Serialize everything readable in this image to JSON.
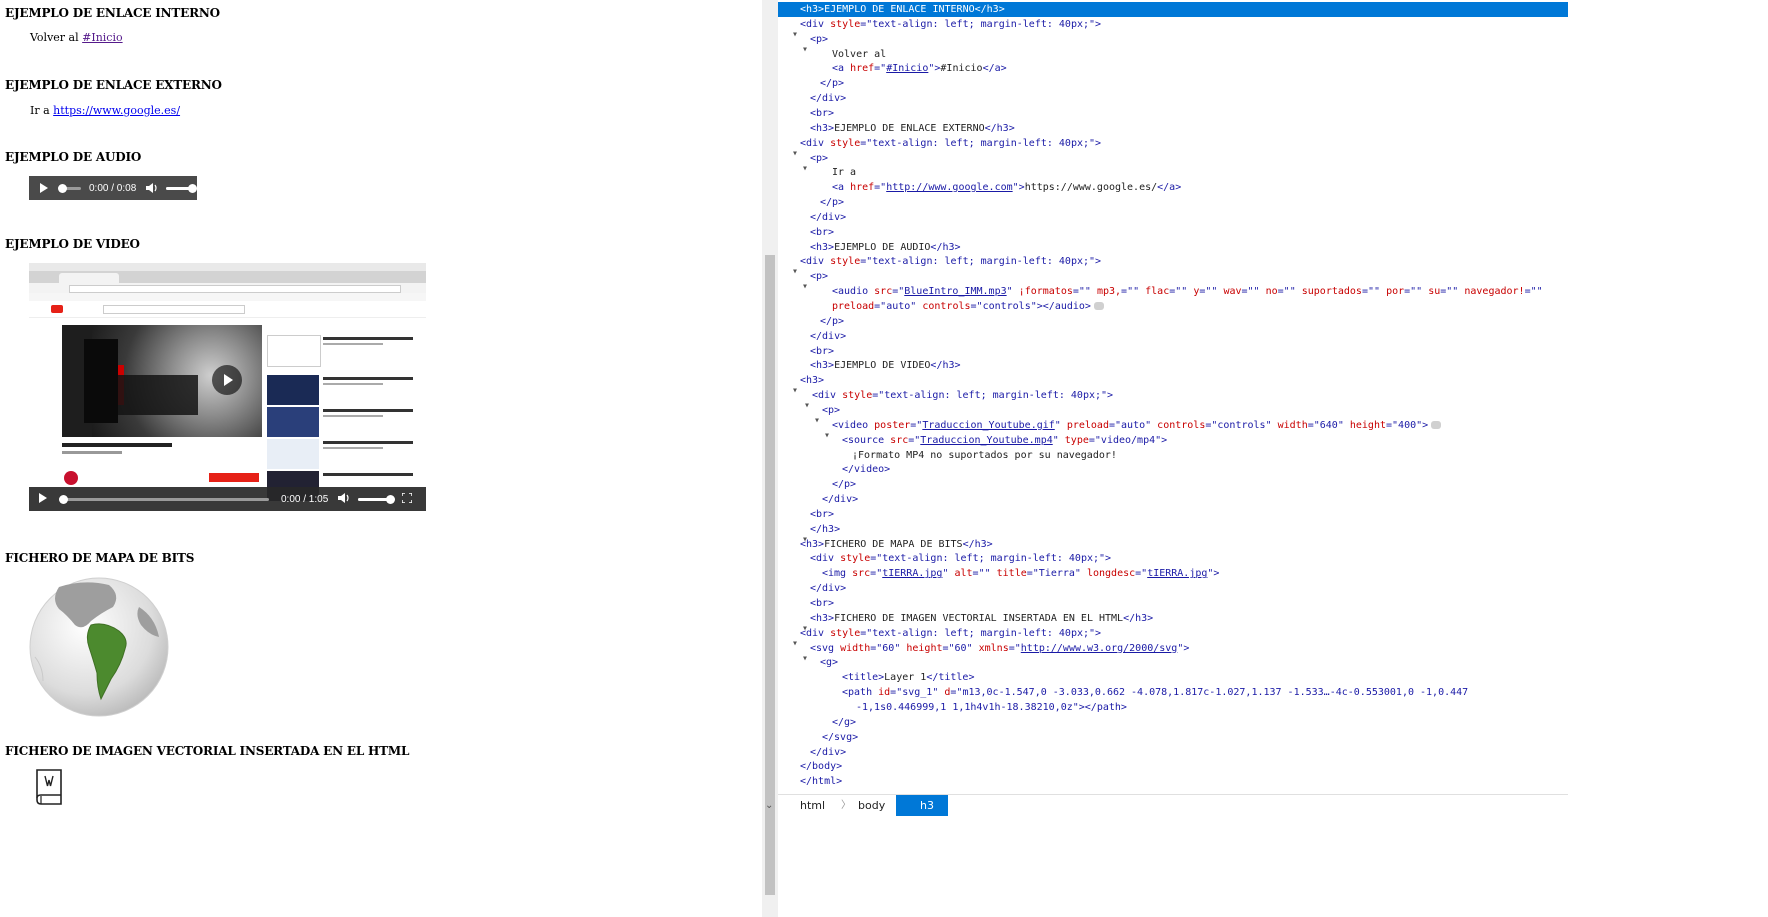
{
  "page": {
    "sections": {
      "internal_link": {
        "heading": "EJEMPLO DE ENLACE INTERNO",
        "text": "Volver al ",
        "link": "#Inicio"
      },
      "external_link": {
        "heading": "EJEMPLO DE ENLACE EXTERNO",
        "text": "Ir a ",
        "link": "https://www.google.es/"
      },
      "audio": {
        "heading": "EJEMPLO DE AUDIO",
        "time": "0:00 / 0:08"
      },
      "video": {
        "heading": "EJEMPLO DE VIDEO",
        "time": "0:00 / 1:05"
      },
      "bitmap": {
        "heading": "FICHERO DE MAPA DE BITS"
      },
      "vector": {
        "heading": "FICHERO DE IMAGEN VECTORIAL INSERTADA EN EL HTML"
      }
    }
  },
  "devtools": {
    "dom_lines": [
      [
        [
          "t",
          "<h3>"
        ],
        [
          "x",
          "EJEMPLO DE ENLACE INTERNO"
        ],
        [
          "t",
          "</h3>"
        ]
      ],
      [
        [
          "t",
          "<div "
        ],
        [
          "an",
          "style"
        ],
        [
          "t",
          "=\""
        ],
        [
          "av",
          "text-align: left; margin-left: 40px;"
        ],
        [
          "t",
          "\">"
        ]
      ],
      [
        [
          "t",
          "<p>"
        ]
      ],
      [
        [
          "x",
          "Volver al"
        ]
      ],
      [
        [
          "t",
          "<a "
        ],
        [
          "an",
          "href"
        ],
        [
          "t",
          "=\""
        ],
        [
          "avl",
          "#Inicio"
        ],
        [
          "t",
          "\">"
        ],
        [
          "x",
          "#Inicio"
        ],
        [
          "t",
          "</a>"
        ]
      ],
      [
        [
          "t",
          "</p>"
        ]
      ],
      [
        [
          "t",
          "</div>"
        ]
      ],
      [
        [
          "t",
          "<br>"
        ]
      ],
      [
        [
          "t",
          "<h3>"
        ],
        [
          "x",
          "EJEMPLO DE ENLACE EXTERNO"
        ],
        [
          "t",
          "</h3>"
        ]
      ],
      [
        [
          "t",
          "<div "
        ],
        [
          "an",
          "style"
        ],
        [
          "t",
          "=\""
        ],
        [
          "av",
          "text-align: left; margin-left: 40px;"
        ],
        [
          "t",
          "\">"
        ]
      ],
      [
        [
          "t",
          "<p>"
        ]
      ],
      [
        [
          "x",
          "Ir a"
        ]
      ],
      [
        [
          "t",
          "<a "
        ],
        [
          "an",
          "href"
        ],
        [
          "t",
          "=\""
        ],
        [
          "avl",
          "http://www.google.com"
        ],
        [
          "t",
          "\">"
        ],
        [
          "x",
          "https://www.google.es/"
        ],
        [
          "t",
          "</a>"
        ]
      ],
      [
        [
          "t",
          "</p>"
        ]
      ],
      [
        [
          "t",
          "</div>"
        ]
      ],
      [
        [
          "t",
          "<br>"
        ]
      ],
      [
        [
          "t",
          "<h3>"
        ],
        [
          "x",
          "EJEMPLO DE AUDIO"
        ],
        [
          "t",
          "</h3>"
        ]
      ],
      [
        [
          "t",
          "<div "
        ],
        [
          "an",
          "style"
        ],
        [
          "t",
          "=\""
        ],
        [
          "av",
          "text-align: left; margin-left: 40px;"
        ],
        [
          "t",
          "\">"
        ]
      ],
      [
        [
          "t",
          "<p>"
        ]
      ],
      [
        [
          "t",
          "<audio "
        ],
        [
          "an",
          "src"
        ],
        [
          "t",
          "=\""
        ],
        [
          "avl",
          "BlueIntro_IMM.mp3"
        ],
        [
          "t",
          "\" "
        ],
        [
          "an",
          "¡formatos"
        ],
        [
          "t",
          "=\"\" "
        ],
        [
          "an",
          "mp3,"
        ],
        [
          "t",
          "=\"\" "
        ],
        [
          "an",
          "flac"
        ],
        [
          "t",
          "=\"\" "
        ],
        [
          "an",
          "y"
        ],
        [
          "t",
          "=\"\" "
        ],
        [
          "an",
          "wav"
        ],
        [
          "t",
          "=\"\" "
        ],
        [
          "an",
          "no"
        ],
        [
          "t",
          "=\"\" "
        ],
        [
          "an",
          "suportados"
        ],
        [
          "t",
          "=\"\" "
        ],
        [
          "an",
          "por"
        ],
        [
          "t",
          "=\"\" "
        ],
        [
          "an",
          "su"
        ],
        [
          "t",
          "=\"\" "
        ],
        [
          "an",
          "navegador!"
        ],
        [
          "t",
          "=\"\""
        ]
      ],
      [
        [
          "an",
          "preload"
        ],
        [
          "t",
          "=\""
        ],
        [
          "av",
          "auto"
        ],
        [
          "t",
          "\" "
        ],
        [
          "an",
          "controls"
        ],
        [
          "t",
          "=\""
        ],
        [
          "av",
          "controls"
        ],
        [
          "t",
          "\"></audio>"
        ],
        [
          "ev",
          ""
        ]
      ],
      [
        [
          "t",
          "</p>"
        ]
      ],
      [
        [
          "t",
          "</div>"
        ]
      ],
      [
        [
          "t",
          "<br>"
        ]
      ],
      [
        [
          "t",
          "<h3>"
        ],
        [
          "x",
          "EJEMPLO DE VIDEO"
        ],
        [
          "t",
          "</h3>"
        ]
      ],
      [
        [
          "t",
          "<h3>"
        ]
      ],
      [
        [
          "t",
          "<div "
        ],
        [
          "an",
          "style"
        ],
        [
          "t",
          "=\""
        ],
        [
          "av",
          "text-align: left; margin-left: 40px;"
        ],
        [
          "t",
          "\">"
        ]
      ],
      [
        [
          "t",
          "<p>"
        ]
      ],
      [
        [
          "t",
          "<video "
        ],
        [
          "an",
          "poster"
        ],
        [
          "t",
          "=\""
        ],
        [
          "avl",
          "Traduccion_Youtube.gif"
        ],
        [
          "t",
          "\" "
        ],
        [
          "an",
          "preload"
        ],
        [
          "t",
          "=\""
        ],
        [
          "av",
          "auto"
        ],
        [
          "t",
          "\" "
        ],
        [
          "an",
          "controls"
        ],
        [
          "t",
          "=\""
        ],
        [
          "av",
          "controls"
        ],
        [
          "t",
          "\" "
        ],
        [
          "an",
          "width"
        ],
        [
          "t",
          "=\""
        ],
        [
          "av",
          "640"
        ],
        [
          "t",
          "\" "
        ],
        [
          "an",
          "height"
        ],
        [
          "t",
          "=\""
        ],
        [
          "av",
          "400"
        ],
        [
          "t",
          "\">"
        ],
        [
          "ev",
          ""
        ]
      ],
      [
        [
          "t",
          "<source "
        ],
        [
          "an",
          "src"
        ],
        [
          "t",
          "=\""
        ],
        [
          "avl",
          "Traduccion_Youtube.mp4"
        ],
        [
          "t",
          "\" "
        ],
        [
          "an",
          "type"
        ],
        [
          "t",
          "=\""
        ],
        [
          "av",
          "video/mp4"
        ],
        [
          "t",
          "\">"
        ]
      ],
      [
        [
          "x",
          "¡Formato MP4 no suportados por su navegador!"
        ]
      ],
      [
        [
          "t",
          "</video>"
        ]
      ],
      [
        [
          "t",
          "</p>"
        ]
      ],
      [
        [
          "t",
          "</div>"
        ]
      ],
      [
        [
          "t",
          "<br>"
        ]
      ],
      [
        [
          "t",
          "</h3>"
        ]
      ],
      [
        [
          "t",
          "<h3>"
        ],
        [
          "x",
          "FICHERO DE MAPA DE BITS"
        ],
        [
          "t",
          "</h3>"
        ]
      ],
      [
        [
          "t",
          "<div "
        ],
        [
          "an",
          "style"
        ],
        [
          "t",
          "=\""
        ],
        [
          "av",
          "text-align: left; margin-left: 40px;"
        ],
        [
          "t",
          "\">"
        ]
      ],
      [
        [
          "t",
          "<img "
        ],
        [
          "an",
          "src"
        ],
        [
          "t",
          "=\""
        ],
        [
          "avl",
          "tIERRA.jpg"
        ],
        [
          "t",
          "\" "
        ],
        [
          "an",
          "alt"
        ],
        [
          "t",
          "=\"\" "
        ],
        [
          "an",
          "title"
        ],
        [
          "t",
          "=\""
        ],
        [
          "av",
          "Tierra"
        ],
        [
          "t",
          "\" "
        ],
        [
          "an",
          "longdesc"
        ],
        [
          "t",
          "=\""
        ],
        [
          "avl",
          "tIERRA.jpg"
        ],
        [
          "t",
          "\">"
        ]
      ],
      [
        [
          "t",
          "</div>"
        ]
      ],
      [
        [
          "t",
          "<br>"
        ]
      ],
      [
        [
          "t",
          "<h3>"
        ],
        [
          "x",
          "FICHERO DE IMAGEN VECTORIAL INSERTADA EN EL HTML"
        ],
        [
          "t",
          "</h3>"
        ]
      ],
      [
        [
          "t",
          "<div "
        ],
        [
          "an",
          "style"
        ],
        [
          "t",
          "=\""
        ],
        [
          "av",
          "text-align: left; margin-left: 40px;"
        ],
        [
          "t",
          "\">"
        ]
      ],
      [
        [
          "t",
          "<svg "
        ],
        [
          "an",
          "width"
        ],
        [
          "t",
          "=\""
        ],
        [
          "av",
          "60"
        ],
        [
          "t",
          "\" "
        ],
        [
          "an",
          "height"
        ],
        [
          "t",
          "=\""
        ],
        [
          "av",
          "60"
        ],
        [
          "t",
          "\" "
        ],
        [
          "an",
          "xmlns"
        ],
        [
          "t",
          "=\""
        ],
        [
          "avl",
          "http://www.w3.org/2000/svg"
        ],
        [
          "t",
          "\">"
        ]
      ],
      [
        [
          "t",
          "<g>"
        ]
      ],
      [
        [
          "t",
          "<title>"
        ],
        [
          "x",
          "Layer 1"
        ],
        [
          "t",
          "</title>"
        ]
      ],
      [
        [
          "t",
          "<path "
        ],
        [
          "an",
          "id"
        ],
        [
          "t",
          "=\""
        ],
        [
          "av",
          "svg_1"
        ],
        [
          "t",
          "\" "
        ],
        [
          "an",
          "d"
        ],
        [
          "t",
          "=\""
        ],
        [
          "av",
          "m13,0c-1.547,0 -3.033,0.662 -4.078,1.817c-1.027,1.137 -1.533…-4c-0.553001,0 -1,0.447"
        ]
      ],
      [
        [
          "av",
          "-1,1s0.446999,1 1,1h4v1h-18.38210,0z"
        ],
        [
          "t",
          "\"></path>"
        ]
      ],
      [
        [
          "t",
          "</g>"
        ]
      ],
      [
        [
          "t",
          "</svg>"
        ]
      ],
      [
        [
          "t",
          "</div>"
        ]
      ],
      [
        [
          "t",
          "</body>"
        ]
      ],
      [
        [
          "t",
          "</html>"
        ]
      ]
    ],
    "breadcrumbs": [
      "html",
      "body",
      "h3"
    ]
  }
}
